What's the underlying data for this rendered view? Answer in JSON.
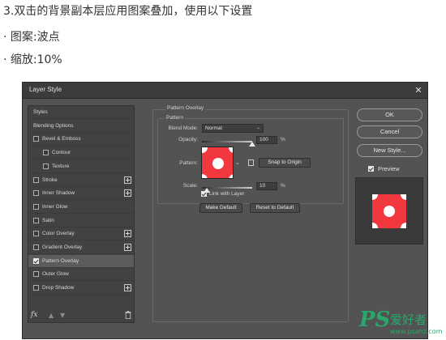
{
  "tutorial": {
    "step_text": "3.双击的背景副本层应用图案叠加，使用以下设置",
    "bullet_pattern": "· 图案:波点",
    "bullet_scale": "· 缩放:10%"
  },
  "dialog": {
    "title": "Layer Style",
    "close_glyph": "✕",
    "styles_list": [
      {
        "label": "Styles",
        "checkbox": false,
        "checked": false,
        "plus": false,
        "indent": 0
      },
      {
        "label": "Blending Options",
        "checkbox": false,
        "checked": false,
        "plus": false,
        "indent": 0
      },
      {
        "label": "Bevel & Emboss",
        "checkbox": true,
        "checked": false,
        "plus": false,
        "indent": 0
      },
      {
        "label": "Contour",
        "checkbox": true,
        "checked": false,
        "plus": false,
        "indent": 1
      },
      {
        "label": "Texture",
        "checkbox": true,
        "checked": false,
        "plus": false,
        "indent": 1
      },
      {
        "label": "Stroke",
        "checkbox": true,
        "checked": false,
        "plus": true,
        "indent": 0
      },
      {
        "label": "Inner Shadow",
        "checkbox": true,
        "checked": false,
        "plus": true,
        "indent": 0
      },
      {
        "label": "Inner Glow",
        "checkbox": true,
        "checked": false,
        "plus": false,
        "indent": 0
      },
      {
        "label": "Satin",
        "checkbox": true,
        "checked": false,
        "plus": false,
        "indent": 0
      },
      {
        "label": "Color Overlay",
        "checkbox": true,
        "checked": false,
        "plus": true,
        "indent": 0
      },
      {
        "label": "Gradient Overlay",
        "checkbox": true,
        "checked": false,
        "plus": true,
        "indent": 0
      },
      {
        "label": "Pattern Overlay",
        "checkbox": true,
        "checked": true,
        "plus": false,
        "indent": 0,
        "selected": true
      },
      {
        "label": "Outer Glow",
        "checkbox": true,
        "checked": false,
        "plus": false,
        "indent": 0
      },
      {
        "label": "Drop Shadow",
        "checkbox": true,
        "checked": false,
        "plus": true,
        "indent": 0
      }
    ],
    "fx_label": "fx",
    "pattern_overlay": {
      "group_title": "Pattern Overlay",
      "sub_title": "Pattern",
      "blend_mode_label": "Blend Mode:",
      "blend_mode_value": "Normal",
      "opacity_label": "Opacity:",
      "opacity_value": "100",
      "opacity_fraction": 1.0,
      "pattern_label": "Pattern:",
      "snap_button": "Snap to Origin",
      "scale_label": "Scale:",
      "scale_value": "10",
      "scale_fraction": 0.1,
      "percent": "%",
      "link_label": "Link with Layer",
      "link_checked": true,
      "make_default": "Make Default",
      "reset_default": "Reset to Default",
      "pattern_color": "#f0383e",
      "dot_color": "#ffffff"
    },
    "right": {
      "ok": "OK",
      "cancel": "Cancel",
      "new_style": "New Style...",
      "preview_label": "Preview",
      "preview_checked": true
    }
  },
  "watermark": {
    "ps": "PS",
    "cn": "爱好者",
    "url": "www.psahz.com"
  }
}
